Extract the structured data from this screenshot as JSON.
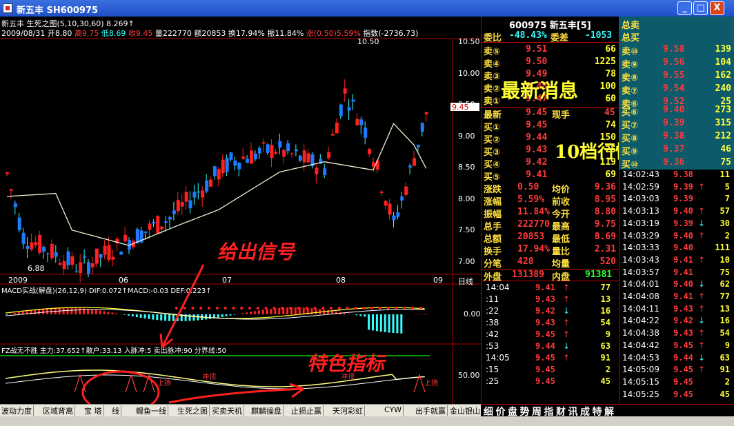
{
  "window": {
    "title": "新五丰  SH600975",
    "min_label": "_",
    "max_label": "□",
    "close_label": "X"
  },
  "chart": {
    "header1": "新五丰 生死之图(5,10,30,60) 8.269↑",
    "header2_date": "2009/08/31",
    "header2_open": "开8.80",
    "header2_high": "高9.75",
    "header2_low": "低8.69",
    "header2_close": "收9.45",
    "header2_vol": "量222770",
    "header2_amt": "额20853",
    "header2_turn": "换17.94%",
    "header2_amp": "振11.84%",
    "header2_chg": "涨(0.50)5.59%",
    "header2_idx": "指数(-2736.73)",
    "high_label": "10.50",
    "low_label": "6.88",
    "price_axis": [
      "10.50",
      "10.00",
      "9.50",
      "9.00",
      "8.50",
      "8.00",
      "7.50",
      "7.00"
    ],
    "current_price_tag": "9.45",
    "time_axis": [
      "2009",
      "06",
      "07",
      "08",
      "09"
    ],
    "period_label": "日线",
    "macd_header": "MACD实战(解盘)(26,12,9)  DIF:0.072↑MACD:-0.03  DEF:0.223↑",
    "macd_axis": "0.00",
    "fz_header": "FZ战无不胜 主力:37.652↑散户:33.13   入脉冲:5 卖出脉冲:90 分界线:50",
    "fz_axis": "50.00",
    "fz_labels": [
      "上扬",
      "冲顶",
      "冲顶",
      "上扬"
    ]
  },
  "annotations": {
    "latest_news": "最新消息",
    "ten_levels": "10档行情",
    "give_signal": "给出信号",
    "special_indicator": "特色指标"
  },
  "quote": {
    "code_name": "600975  新五丰[5]",
    "weibi_label": "委比",
    "weibi_value": "-48.43%",
    "weicha_label": "委差",
    "weicha_value": "-1053",
    "sell": [
      {
        "label": "卖⑤",
        "price": "9.51",
        "vol": "66"
      },
      {
        "label": "卖④",
        "price": "9.50",
        "vol": "1225"
      },
      {
        "label": "卖③",
        "price": "9.49",
        "vol": "78"
      },
      {
        "label": "卖②",
        "price": "9.48",
        "vol": "100"
      },
      {
        "label": "卖①",
        "price": "9.47",
        "vol": "60"
      }
    ],
    "latest_label": "最新",
    "latest_value": "9.45",
    "xianshou_label": "现手",
    "xianshou_value": "45",
    "buy": [
      {
        "label": "买①",
        "price": "9.45",
        "vol": "74"
      },
      {
        "label": "买②",
        "price": "9.44",
        "vol": "150"
      },
      {
        "label": "买③",
        "price": "9.43",
        "vol": "25"
      },
      {
        "label": "买④",
        "price": "9.42",
        "vol": "119"
      },
      {
        "label": "买⑤",
        "price": "9.41",
        "vol": "69"
      }
    ],
    "stats": [
      {
        "l1": "涨跌",
        "v1": "0.50",
        "l2": "均价",
        "v2": "9.36"
      },
      {
        "l1": "涨幅",
        "v1": "5.59%",
        "l2": "前收",
        "v2": "8.95"
      },
      {
        "l1": "振幅",
        "v1": "11.84%",
        "l2": "今开",
        "v2": "8.80"
      },
      {
        "l1": "总手",
        "v1": "222770",
        "l2": "最高",
        "v2": "9.75"
      },
      {
        "l1": "总额",
        "v1": "20853",
        "l2": "最低",
        "v2": "8.69"
      },
      {
        "l1": "换手",
        "v1": "17.94%",
        "l2": "量比",
        "v2": "2.31"
      },
      {
        "l1": "分笔",
        "v1": "428",
        "l2": "均量",
        "v2": "520"
      }
    ],
    "outer_label": "外盘",
    "outer_value": "131389",
    "inner_label": "内盘",
    "inner_value": "91381",
    "ticks": [
      {
        "t": "14:04",
        "p": "9.41",
        "d": "↑",
        "v": "77"
      },
      {
        "t": ":11",
        "p": "9.43",
        "d": "↑",
        "v": "13"
      },
      {
        "t": ":22",
        "p": "9.42",
        "d": "↓",
        "v": "16"
      },
      {
        "t": ":38",
        "p": "9.43",
        "d": "↑",
        "v": "54"
      },
      {
        "t": ":42",
        "p": "9.45",
        "d": "↑",
        "v": "9"
      },
      {
        "t": ":53",
        "p": "9.44",
        "d": "↓",
        "v": "63"
      },
      {
        "t": "14:05",
        "p": "9.45",
        "d": "↑",
        "v": "91"
      },
      {
        "t": ":15",
        "p": "9.45",
        "d": "",
        "v": "2"
      },
      {
        "t": ":25",
        "p": "9.45",
        "d": "",
        "v": "45"
      }
    ]
  },
  "levels": {
    "total_sell": "总卖",
    "total_buy": "总买",
    "sell": [
      {
        "label": "卖⑩",
        "price": "9.58",
        "vol": "139"
      },
      {
        "label": "卖⑨",
        "price": "9.56",
        "vol": "104"
      },
      {
        "label": "卖⑧",
        "price": "9.55",
        "vol": "162"
      },
      {
        "label": "卖⑦",
        "price": "9.54",
        "vol": "240"
      },
      {
        "label": "卖⑥",
        "price": "9.52",
        "vol": "25"
      }
    ],
    "buy": [
      {
        "label": "买⑥",
        "price": "9.40",
        "vol": "273"
      },
      {
        "label": "买⑦",
        "price": "9.39",
        "vol": "315"
      },
      {
        "label": "买⑧",
        "price": "9.38",
        "vol": "212"
      },
      {
        "label": "买⑨",
        "price": "9.37",
        "vol": "46"
      },
      {
        "label": "买⑩",
        "price": "9.36",
        "vol": "75"
      }
    ]
  },
  "trades": [
    {
      "t": "14:02:43",
      "p": "9.38",
      "d": "",
      "v": "11"
    },
    {
      "t": "14:02:59",
      "p": "9.39",
      "d": "↑",
      "v": "5"
    },
    {
      "t": "14:03:03",
      "p": "9.39",
      "d": "",
      "v": "7"
    },
    {
      "t": "14:03:13",
      "p": "9.40",
      "d": "↑",
      "v": "57"
    },
    {
      "t": "14:03:19",
      "p": "9.39",
      "d": "↓",
      "v": "30"
    },
    {
      "t": "14:03:29",
      "p": "9.40",
      "d": "↑",
      "v": "2"
    },
    {
      "t": "14:03:33",
      "p": "9.40",
      "d": "",
      "v": "111"
    },
    {
      "t": "14:03:43",
      "p": "9.41",
      "d": "↑",
      "v": "10"
    },
    {
      "t": "14:03:57",
      "p": "9.41",
      "d": "",
      "v": "75"
    },
    {
      "t": "14:04:01",
      "p": "9.40",
      "d": "↓",
      "v": "62"
    },
    {
      "t": "14:04:08",
      "p": "9.41",
      "d": "↑",
      "v": "77"
    },
    {
      "t": "14:04:11",
      "p": "9.43",
      "d": "↑",
      "v": "13"
    },
    {
      "t": "14:04:22",
      "p": "9.42",
      "d": "↓",
      "v": "16"
    },
    {
      "t": "14:04:38",
      "p": "9.43",
      "d": "↑",
      "v": "54"
    },
    {
      "t": "14:04:42",
      "p": "9.45",
      "d": "↑",
      "v": "9"
    },
    {
      "t": "14:04:53",
      "p": "9.44",
      "d": "↓",
      "v": "63"
    },
    {
      "t": "14:05:09",
      "p": "9.45",
      "d": "↑",
      "v": "91"
    },
    {
      "t": "14:05:15",
      "p": "9.45",
      "d": "",
      "v": "2"
    },
    {
      "t": "14:05:25",
      "p": "9.45",
      "d": "",
      "v": "45"
    }
  ],
  "bottom_tabs": [
    "波动力度",
    "区域背离",
    "宝 塔",
    "线",
    "鲤鱼一线",
    "生死之图",
    "买卖天机",
    "麒麟操盘",
    "止损止赢",
    "天河彩虹",
    "CYW",
    "出手就赢",
    "金山银山"
  ],
  "right_tabs": [
    "细",
    "价",
    "盘",
    "势",
    "周",
    "指",
    "财",
    "讯",
    "成",
    "特",
    "解"
  ],
  "colors": {
    "up": "#ff2020",
    "down": "#1e7bff",
    "cyan": "#33ffff",
    "yellow": "#ffff33",
    "panel_teal": "#0c5a6a"
  }
}
